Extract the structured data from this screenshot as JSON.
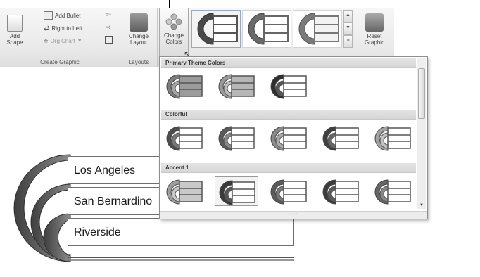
{
  "ribbon": {
    "create_graphic": {
      "add_shape_label": "Add\nShape",
      "add_bullet_label": "Add Bullet",
      "right_to_left_label": "Right to Left",
      "org_chart_label": "Org Chart",
      "group_label": "Create Graphic"
    },
    "layouts": {
      "change_layout_label": "Change\nLayout",
      "group_label": "Layouts"
    },
    "change_colors_label": "Change\nColors",
    "reset_graphic_label": "Reset\nGraphic"
  },
  "dropdown": {
    "sections": [
      {
        "title": "Primary Theme Colors",
        "count": 3
      },
      {
        "title": "Colorful",
        "count": 5
      },
      {
        "title": "Accent 1",
        "count": 5
      }
    ]
  },
  "smartart": {
    "items": [
      "Los Angeles",
      "San Bernardino",
      "Riverside"
    ]
  }
}
